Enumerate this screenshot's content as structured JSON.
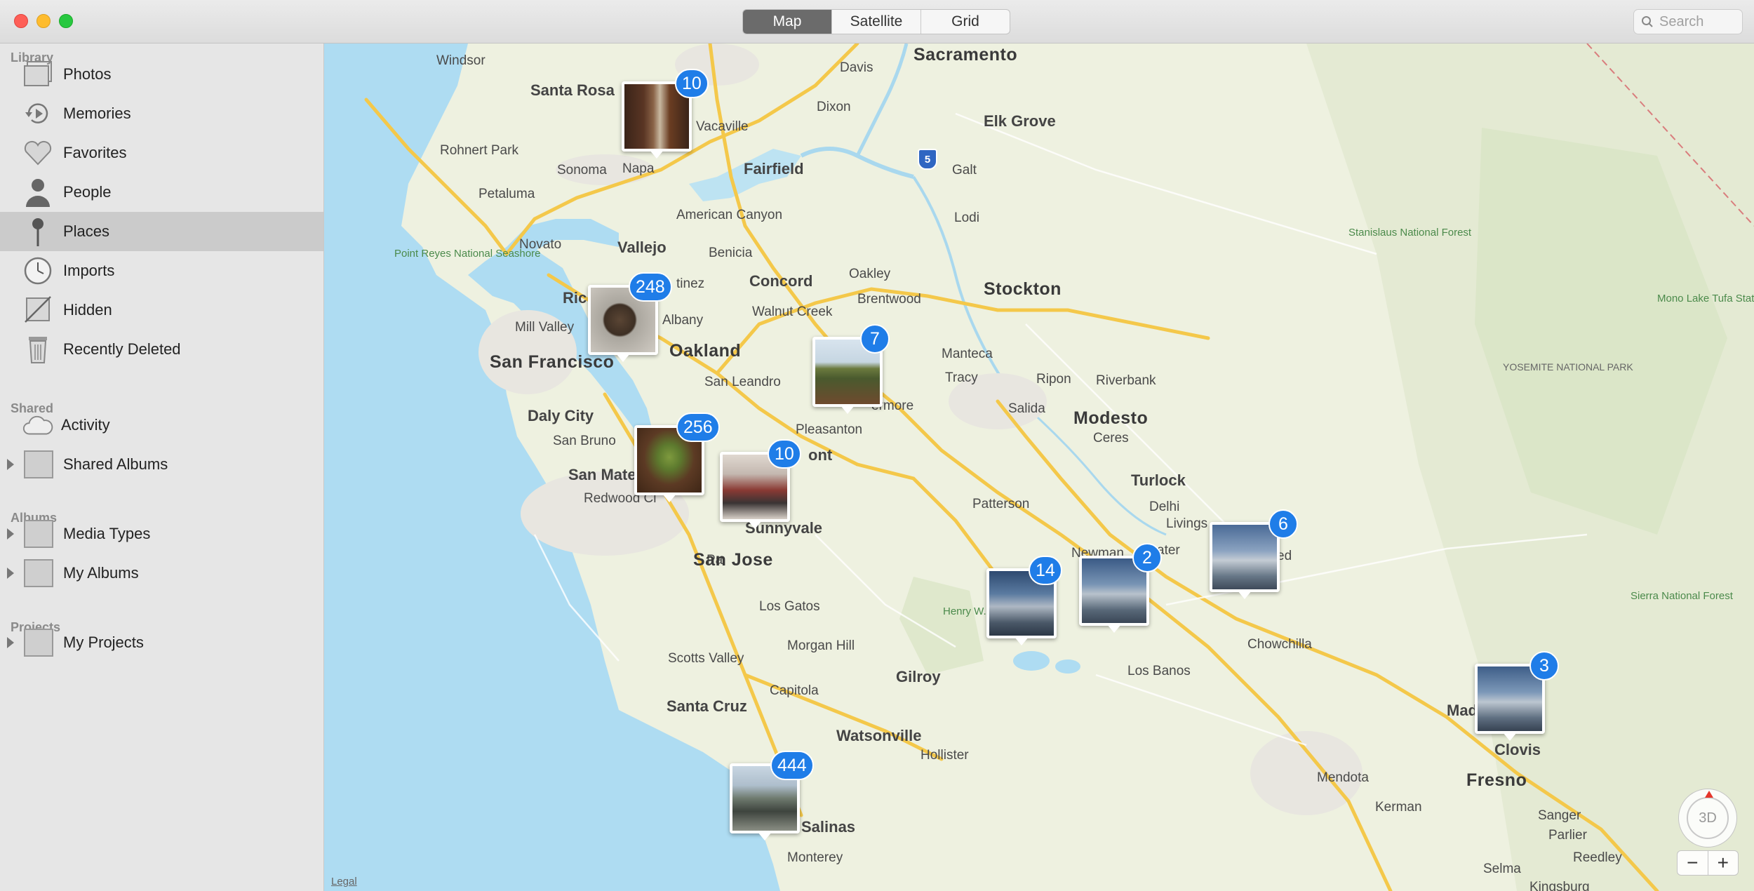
{
  "toolbar": {
    "views": [
      "Map",
      "Satellite",
      "Grid"
    ],
    "active_view": "Map",
    "search_placeholder": "Search"
  },
  "sidebar": {
    "library_title": "Library",
    "library_items": [
      {
        "label": "Photos",
        "icon": "photos-icon"
      },
      {
        "label": "Memories",
        "icon": "memories-icon"
      },
      {
        "label": "Favorites",
        "icon": "heart-icon"
      },
      {
        "label": "People",
        "icon": "person-icon"
      },
      {
        "label": "Places",
        "icon": "pin-icon",
        "selected": true
      },
      {
        "label": "Imports",
        "icon": "clock-icon"
      },
      {
        "label": "Hidden",
        "icon": "hidden-icon"
      },
      {
        "label": "Recently Deleted",
        "icon": "trash-icon"
      }
    ],
    "shared_title": "Shared",
    "shared_items": [
      {
        "label": "Activity",
        "icon": "cloud-icon"
      },
      {
        "label": "Shared Albums",
        "icon": "album-icon"
      }
    ],
    "albums_title": "Albums",
    "album_items": [
      {
        "label": "Media Types",
        "icon": "album-icon"
      },
      {
        "label": "My Albums",
        "icon": "album-icon"
      }
    ],
    "projects_title": "Projects",
    "project_items": [
      {
        "label": "My Projects",
        "icon": "album-icon"
      }
    ]
  },
  "map": {
    "cities": {
      "sacramento": "Sacramento",
      "windsor": "Windsor",
      "santa_rosa": "Santa Rosa",
      "davis": "Davis",
      "dixon": "Dixon",
      "elk_grove": "Elk Grove",
      "vacaville": "Vacaville",
      "rohnert_park": "Rohnert Park",
      "napa": "Napa",
      "sonoma": "Sonoma",
      "fairfield": "Fairfield",
      "galt": "Galt",
      "petaluma": "Petaluma",
      "american_canyon": "American Canyon",
      "lodi": "Lodi",
      "novato": "Novato",
      "vallejo": "Vallejo",
      "benicia": "Benicia",
      "martinez": "tinez",
      "concord": "Concord",
      "oakley": "Oakley",
      "stockton": "Stockton",
      "richmond": "Ric",
      "brentwood": "Brentwood",
      "albany": "Albany",
      "walnut_creek": "Walnut Creek",
      "mill_valley": "Mill Valley",
      "san_francisco": "San Francisco",
      "oakland": "Oakland",
      "manteca": "Manteca",
      "san_leandro": "San Leandro",
      "tracy": "Tracy",
      "ripon": "Ripon",
      "riverbank": "Riverbank",
      "livermore": "ermore",
      "daly_city": "Daly City",
      "pleasanton": "Pleasanton",
      "salida": "Salida",
      "modesto": "Modesto",
      "san_bruno": "San Bruno",
      "fremont": "ont",
      "ceres": "Ceres",
      "san_mateo": "San Mate",
      "redwood_city": "Redwood Ci",
      "turlock": "Turlock",
      "patterson": "Patterson",
      "delhi": "Delhi",
      "sunnyvale": "Sunnyvale",
      "livingston": "Livings",
      "newman": "Newman",
      "atwater": "twater",
      "merced": "ed",
      "san_jose": "San Jose",
      "los_gatos": "Los Gatos",
      "chowchilla": "Chowchilla",
      "morgan_hill": "Morgan Hill",
      "scotts_valley": "Scotts Valley",
      "los_banos": "Los Banos",
      "gilroy": "Gilroy",
      "capitola": "Capitola",
      "santa_cruz": "Santa Cruz",
      "madera": "Madera",
      "watsonville": "Watsonville",
      "clovis": "Clovis",
      "hollister": "Hollister",
      "fresno": "Fresno",
      "mendota": "Mendota",
      "kerman": "Kerman",
      "sanger": "Sanger",
      "salinas": "Salinas",
      "parlier": "Parlier",
      "monterey": "Monterey",
      "reedley": "Reedley",
      "selma": "Selma",
      "kingsburg": "Kingsburg",
      "palo_alto": "Pa"
    },
    "parks": {
      "point_reyes": "Point Reyes National Seashore",
      "stanislaus": "Stanislaus National Forest",
      "mono_lake": "Mono Lake Tufa State Natural Reserve",
      "yosemite": "YOSEMITE NATIONAL PARK",
      "sierra": "Sierra National Forest",
      "henry_coe": "Henry W. State P"
    },
    "highway_shield": "5",
    "clusters": [
      {
        "count": "10",
        "theme": "doorway"
      },
      {
        "count": "248",
        "theme": "dog"
      },
      {
        "count": "7",
        "theme": "vineyard"
      },
      {
        "count": "256",
        "theme": "plant"
      },
      {
        "count": "10",
        "theme": "person"
      },
      {
        "count": "14",
        "theme": "sky"
      },
      {
        "count": "2",
        "theme": "sky"
      },
      {
        "count": "6",
        "theme": "sky"
      },
      {
        "count": "3",
        "theme": "sky"
      },
      {
        "count": "444",
        "theme": "coast"
      }
    ],
    "legal": "Legal",
    "compass_label": "3D",
    "zoom_out": "−",
    "zoom_in": "+"
  }
}
